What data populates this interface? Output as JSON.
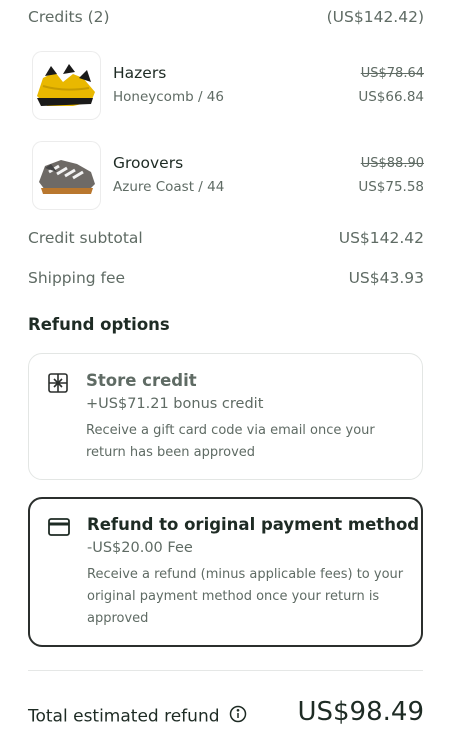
{
  "credits": {
    "label": "Credits (2)",
    "amount": "(US$142.42)"
  },
  "items": [
    {
      "name": "Hazers",
      "variant": "Honeycomb / 46",
      "old_price": "US$78.64",
      "new_price": "US$66.84",
      "thumb_color": "#e6b800"
    },
    {
      "name": "Groovers",
      "variant": "Azure Coast / 44",
      "old_price": "US$88.90",
      "new_price": "US$75.58",
      "thumb_color": "#6e6a66"
    }
  ],
  "summary": {
    "subtotal_label": "Credit subtotal",
    "subtotal_value": "US$142.42",
    "shipping_label": "Shipping fee",
    "shipping_value": "US$43.93"
  },
  "refund": {
    "title": "Refund options",
    "options": [
      {
        "icon": "gift-card-icon",
        "title": "Store credit",
        "subtitle": "+US$71.21 bonus credit",
        "description": "Receive a gift card code via email once your return has been approved",
        "selected": false
      },
      {
        "icon": "credit-card-icon",
        "title": "Refund to original payment method",
        "subtitle": "-US$20.00 Fee",
        "description": "Receive a refund (minus applicable fees) to your original payment method once your return is approved",
        "selected": true
      }
    ]
  },
  "total": {
    "label": "Total estimated refund",
    "value": "US$98.49"
  },
  "colors": {
    "text": "#1e2b24",
    "muted": "#5f6b64",
    "selected_border": "#2b2f2d",
    "card_border": "#e3e6e4"
  }
}
